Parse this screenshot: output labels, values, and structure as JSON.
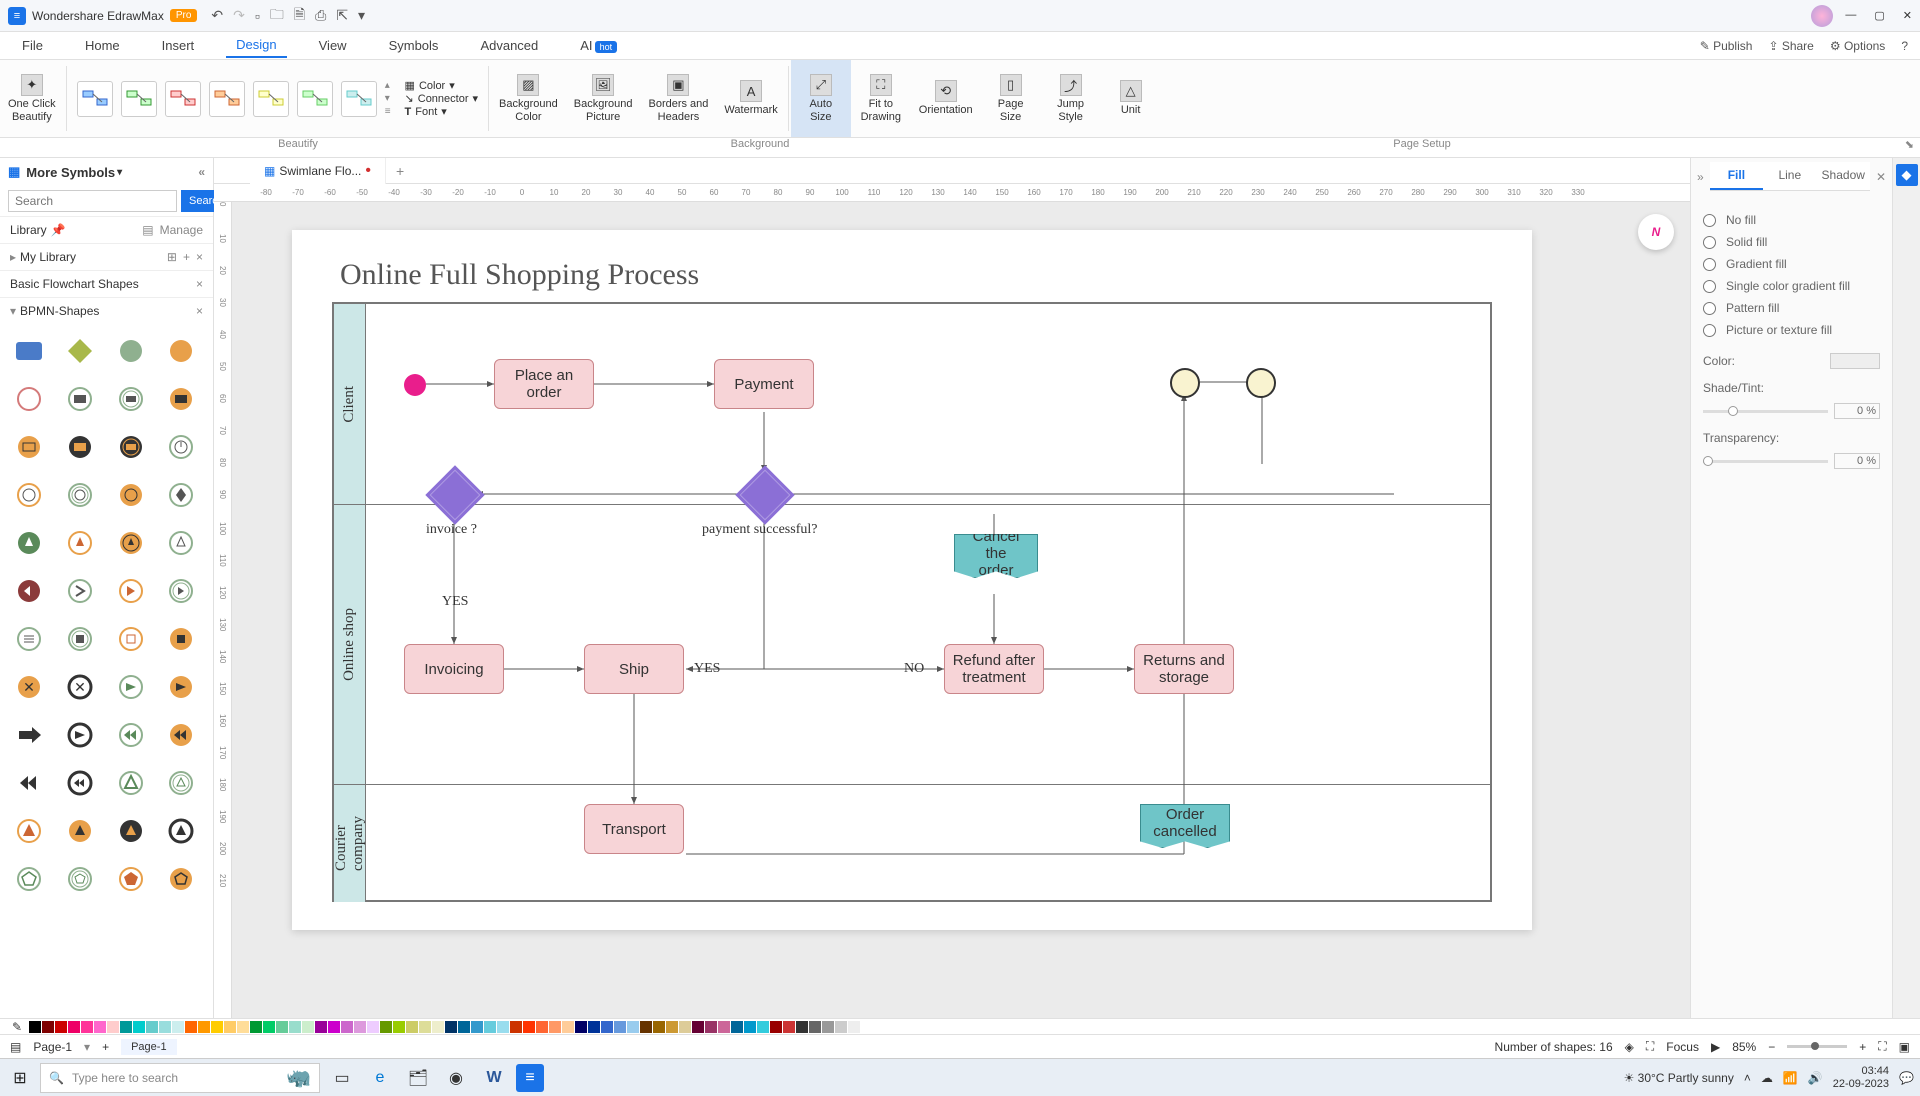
{
  "titlebar": {
    "app_name": "Wondershare EdrawMax",
    "pro": "Pro"
  },
  "menubar": {
    "items": [
      "File",
      "Home",
      "Insert",
      "Design",
      "View",
      "Symbols",
      "Advanced",
      "AI"
    ],
    "hot": "hot",
    "active_index": 3,
    "right": {
      "publish": "Publish",
      "share": "Share",
      "options": "Options"
    }
  },
  "ribbon": {
    "one_click": "One Click\nBeautify",
    "color": "Color",
    "connector": "Connector",
    "font": "Font",
    "bg_color": "Background\nColor",
    "bg_picture": "Background\nPicture",
    "borders": "Borders and\nHeaders",
    "watermark": "Watermark",
    "auto_size": "Auto\nSize",
    "fit": "Fit to\nDrawing",
    "orientation": "Orientation",
    "page_size": "Page\nSize",
    "jump_style": "Jump\nStyle",
    "unit": "Unit",
    "group_beautify": "Beautify",
    "group_background": "Background",
    "group_pagesetup": "Page Setup"
  },
  "left_panel": {
    "title": "More Symbols",
    "search_placeholder": "Search",
    "search_btn": "Search",
    "library": "Library",
    "manage": "Manage",
    "my_library": "My Library",
    "basic_flowchart": "Basic Flowchart Shapes",
    "bpmn": "BPMN-Shapes"
  },
  "doc_tab": {
    "name": "Swimlane Flo...",
    "close": "×"
  },
  "ruler_h": [
    "-80",
    "-70",
    "-60",
    "-50",
    "-40",
    "-30",
    "-20",
    "-10",
    "0",
    "10",
    "20",
    "30",
    "40",
    "50",
    "60",
    "70",
    "80",
    "90",
    "100",
    "110",
    "120",
    "130",
    "140",
    "150",
    "160",
    "170",
    "180",
    "190",
    "200",
    "210",
    "220",
    "230",
    "240",
    "250",
    "260",
    "270",
    "280",
    "290",
    "300",
    "310",
    "320",
    "330"
  ],
  "ruler_v": [
    "0",
    "10",
    "20",
    "30",
    "40",
    "50",
    "60",
    "70",
    "80",
    "90",
    "100",
    "110",
    "120",
    "130",
    "140",
    "150",
    "160",
    "170",
    "180",
    "190",
    "200",
    "210"
  ],
  "flowchart": {
    "title": "Online Full Shopping Process",
    "lanes": {
      "client": "Client",
      "shop": "Online shop",
      "courier": "Courier\ncompany"
    },
    "nodes": {
      "place_order": "Place an\norder",
      "payment": "Payment",
      "invoice_q": "invoice ?",
      "payment_q": "payment successful?",
      "yes1": "YES",
      "yes2": "YES",
      "no": "NO",
      "invoicing": "Invoicing",
      "ship": "Ship",
      "refund": "Refund after\ntreatment",
      "returns": "Returns and\nstorage",
      "cancel": "Cancel the\norder",
      "transport": "Transport",
      "order_cancelled": "Order\ncancelled"
    }
  },
  "right_panel": {
    "tabs": {
      "fill": "Fill",
      "line": "Line",
      "shadow": "Shadow"
    },
    "no_fill": "No fill",
    "solid_fill": "Solid fill",
    "gradient_fill": "Gradient fill",
    "single_color": "Single color gradient fill",
    "pattern_fill": "Pattern fill",
    "picture_fill": "Picture or texture fill",
    "color": "Color:",
    "shade": "Shade/Tint:",
    "transparency": "Transparency:",
    "pct": "0 %"
  },
  "statusbar": {
    "page_sel": "Page-1",
    "page_tab": "Page-1",
    "shapes": "Number of shapes: 16",
    "focus": "Focus",
    "zoom": "85%"
  },
  "taskbar": {
    "search_placeholder": "Type here to search",
    "weather": "30°C  Partly sunny",
    "time": "03:44",
    "date": "22-09-2023"
  },
  "palette_colors": [
    "#000",
    "#7f0000",
    "#c00",
    "#e06",
    "#f39",
    "#f6c",
    "#fcc",
    "#099",
    "#0cc",
    "#6cc",
    "#9dd",
    "#cee",
    "#f60",
    "#f90",
    "#fc0",
    "#fc6",
    "#fd9",
    "#093",
    "#0c6",
    "#6c9",
    "#9dc",
    "#cec",
    "#909",
    "#c0c",
    "#c6c",
    "#d9d",
    "#ecf",
    "#690",
    "#9c0",
    "#cc6",
    "#dd9",
    "#eec",
    "#036",
    "#069",
    "#39c",
    "#6cd",
    "#9de",
    "#c30",
    "#f30",
    "#f63",
    "#f96",
    "#fc9",
    "#006",
    "#039",
    "#36c",
    "#69d",
    "#9ce",
    "#630",
    "#960",
    "#c93",
    "#dc9",
    "#603",
    "#936",
    "#c69",
    "#069",
    "#09c",
    "#3cd",
    "#900",
    "#c33",
    "#333",
    "#666",
    "#999",
    "#ccc",
    "#eee"
  ]
}
